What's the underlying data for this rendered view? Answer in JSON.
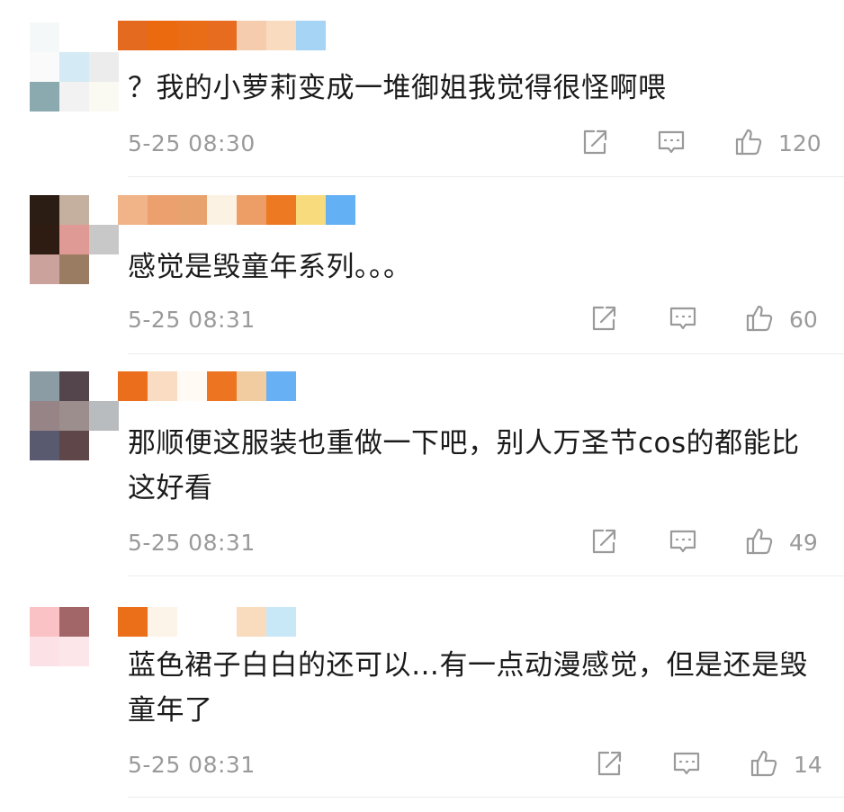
{
  "comments": [
    {
      "avatar": [
        "#f4f8f8",
        "#ffffff",
        "#ffffff",
        "#fafafa",
        "#d4eaf4",
        "#ececec",
        "#8aaab0",
        "#f2f2f2",
        "#fbfaf2"
      ],
      "name_colors": [
        "#e36a1e",
        "#eb690f",
        "#e96c16",
        "#e76c20",
        "#f6ccae",
        "#f9dcc0",
        "#a6d4f4"
      ],
      "text": "？我的小萝莉变成一堆御姐我觉得很怪啊喂",
      "time": "5-25 08:30",
      "likes": "120"
    },
    {
      "avatar": [
        "#2b1c14",
        "#c5b0a0",
        "#ffffff",
        "#2e1c12",
        "#e09a96",
        "#c8c8c8",
        "#cca29c",
        "#9a7c62",
        "#ffffff"
      ],
      "name_colors": [
        "#f1b489",
        "#eba06e",
        "#e8a26e",
        "#fcf2e4",
        "#ed9e66",
        "#ed7a22",
        "#f7db7c",
        "#63b0f4"
      ],
      "text": "感觉是毁童年系列。。。",
      "time": "5-25 08:31",
      "likes": "60"
    },
    {
      "avatar": [
        "#8c9ca4",
        "#54444c",
        "#ffffff",
        "#968486",
        "#9b8e8c",
        "#b8bcbe",
        "#595a70",
        "#5f4648",
        "#ffffff"
      ],
      "name_colors": [
        "#eb6e1c",
        "#f9dcc2",
        "#fffbf4",
        "#ed7522",
        "#f0cca0",
        "#67b0f4"
      ],
      "text": "那顺便这服装也重做一下吧，别人万圣节cos的都能比这好看",
      "time": "5-25 08:31",
      "likes": "49"
    },
    {
      "avatar": [
        "#fac2c4",
        "#a26668",
        "#ffffff",
        "#fce2e6",
        "#fde6ea",
        "#ffffff",
        "#ffffff",
        "#ffffff",
        "#ffffff"
      ],
      "name_colors": [
        "#eb6e18",
        "#fcf4e8",
        "#ffffff",
        "#ffffff",
        "#f9dcbe",
        "#c8e8f8"
      ],
      "text": "蓝色裙子白白的还可以…有一点动漫感觉，但是还是毁童年了",
      "time": "5-25 08:31",
      "likes": "14"
    }
  ],
  "icons": {
    "share": "share-icon",
    "reply": "comment-icon",
    "like": "thumbs-up-icon"
  }
}
